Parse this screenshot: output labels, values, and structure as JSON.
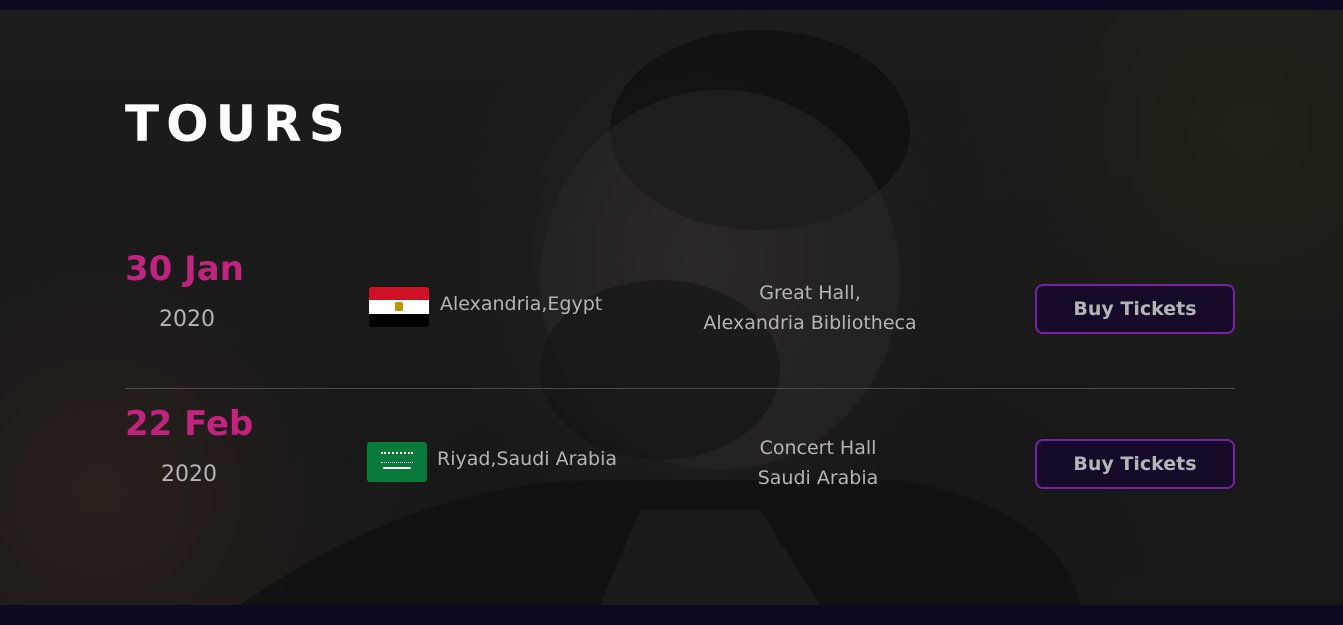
{
  "section": {
    "title": "TOURS"
  },
  "tours": [
    {
      "day_month": "30 Jan",
      "year": "2020",
      "flag_icon": "egypt-flag-icon",
      "city": "Alexandria,Egypt",
      "venue_line1": "Great Hall,",
      "venue_line2": "Alexandria Bibliotheca",
      "button_label": "Buy Tickets"
    },
    {
      "day_month": "22 Feb",
      "year": "2020",
      "flag_icon": "saudi-arabia-flag-icon",
      "city": "Riyad,Saudi Arabia",
      "venue_line1": "Concert Hall",
      "venue_line2": "Saudi Arabia",
      "button_label": "Buy Tickets"
    }
  ],
  "colors": {
    "accent": "#c0247e",
    "button_border": "#7a1fa0",
    "page_background": "#0b0a22",
    "text_muted": "#b5b5b8"
  }
}
